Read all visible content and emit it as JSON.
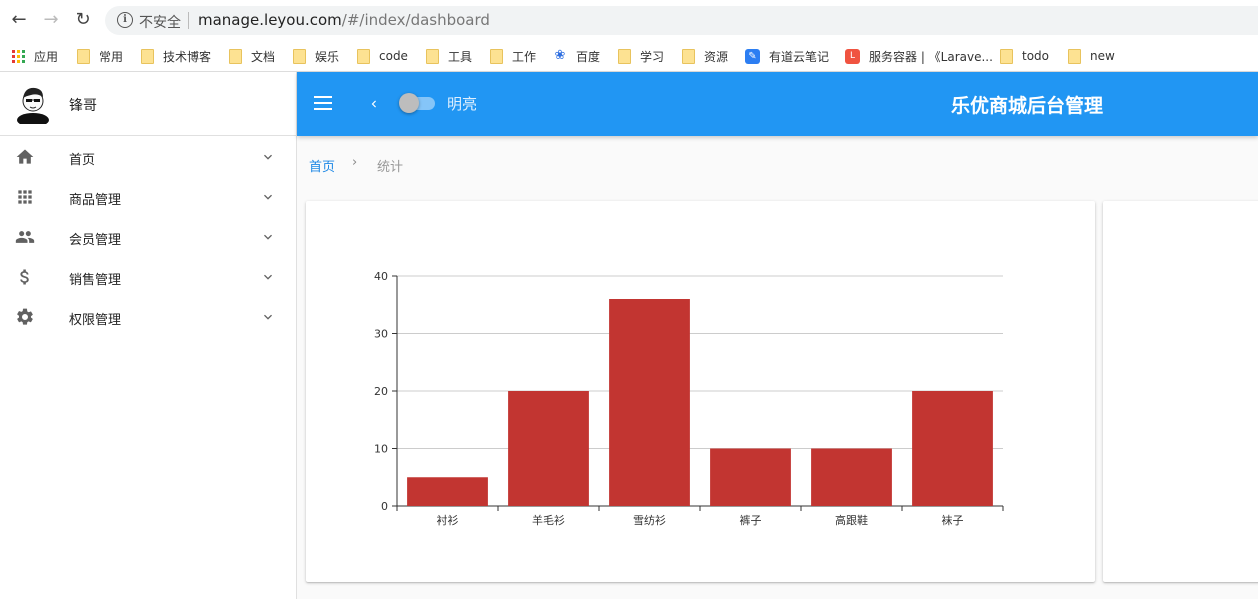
{
  "browser": {
    "security_text": "不安全",
    "url_host": "manage.leyou.com",
    "url_path": "/#/index/dashboard",
    "bookmarks": [
      {
        "label": "应用",
        "icon": "apps-grid-icon"
      },
      {
        "label": "常用",
        "icon": "folder-icon"
      },
      {
        "label": "技术博客",
        "icon": "folder-icon"
      },
      {
        "label": "文档",
        "icon": "folder-icon"
      },
      {
        "label": "娱乐",
        "icon": "folder-icon"
      },
      {
        "label": "code",
        "icon": "folder-icon"
      },
      {
        "label": "工具",
        "icon": "folder-icon"
      },
      {
        "label": "工作",
        "icon": "folder-icon"
      },
      {
        "label": "百度",
        "icon": "baidu-paw-icon"
      },
      {
        "label": "学习",
        "icon": "folder-icon"
      },
      {
        "label": "资源",
        "icon": "folder-icon"
      },
      {
        "label": "有道云笔记",
        "icon": "youdao-note-icon"
      },
      {
        "label": "服务容器 | 《Larave...",
        "icon": "laravel-icon"
      },
      {
        "label": "todo",
        "icon": "folder-icon"
      },
      {
        "label": "new",
        "icon": "folder-icon"
      }
    ]
  },
  "sidebar": {
    "user_name": "锋哥",
    "items": [
      {
        "label": "首页",
        "icon": "home-icon"
      },
      {
        "label": "商品管理",
        "icon": "apps-icon"
      },
      {
        "label": "会员管理",
        "icon": "people-icon"
      },
      {
        "label": "销售管理",
        "icon": "dollar-icon"
      },
      {
        "label": "权限管理",
        "icon": "settings-icon"
      }
    ]
  },
  "toolbar": {
    "theme_label": "明亮",
    "title": "乐优商城后台管理"
  },
  "breadcrumb": {
    "home": "首页",
    "separator": "›",
    "current": "统计"
  },
  "colors": {
    "primary": "#2196f3",
    "bar": "#c23531"
  },
  "chart_data": {
    "type": "bar",
    "categories": [
      "衬衫",
      "羊毛衫",
      "雪纺衫",
      "裤子",
      "高跟鞋",
      "袜子"
    ],
    "values": [
      5,
      20,
      36,
      10,
      10,
      20
    ],
    "ylim": [
      0,
      40
    ],
    "yticks": [
      0,
      10,
      20,
      30,
      40
    ],
    "grid": true
  }
}
